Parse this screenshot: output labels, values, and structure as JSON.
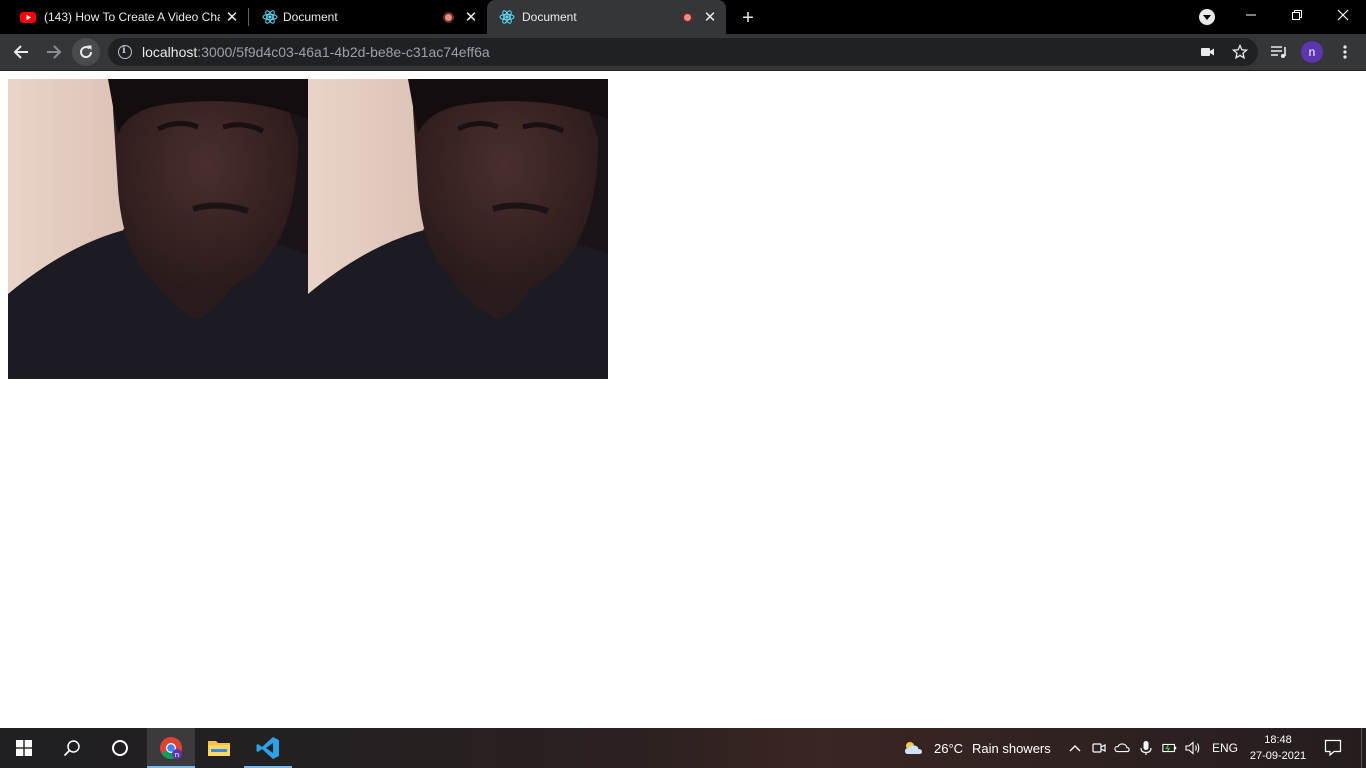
{
  "browser": {
    "tabs": [
      {
        "title": "(143) How To Create A Video Cha",
        "favicon": "youtube-icon",
        "active": false
      },
      {
        "title": "Document",
        "favicon": "react-icon",
        "recording": true,
        "active": false
      },
      {
        "title": "Document",
        "favicon": "react-icon",
        "recording": true,
        "active": true
      }
    ],
    "url_host": "localhost",
    "url_rest": ":3000/5f9d4c03-46a1-4b2d-be8e-c31ac74eff6a",
    "profile_initial": "n",
    "colors": {
      "tabstrip": "#000000",
      "toolbar": "#35363a",
      "omnibox": "#202124",
      "avatar": "#5e35b1"
    }
  },
  "page": {
    "videos": [
      {
        "name": "local-video",
        "description": "webcam-feed"
      },
      {
        "name": "remote-video",
        "description": "webcam-feed"
      }
    ]
  },
  "taskbar": {
    "weather": {
      "temp": "26°C",
      "condition": "Rain showers"
    },
    "language": "ENG",
    "time": "18:48",
    "date": "27-09-2021",
    "pinned": [
      "start-icon",
      "search-icon",
      "cortana-icon",
      "chrome-icon",
      "file-explorer-icon",
      "vscode-icon"
    ]
  }
}
